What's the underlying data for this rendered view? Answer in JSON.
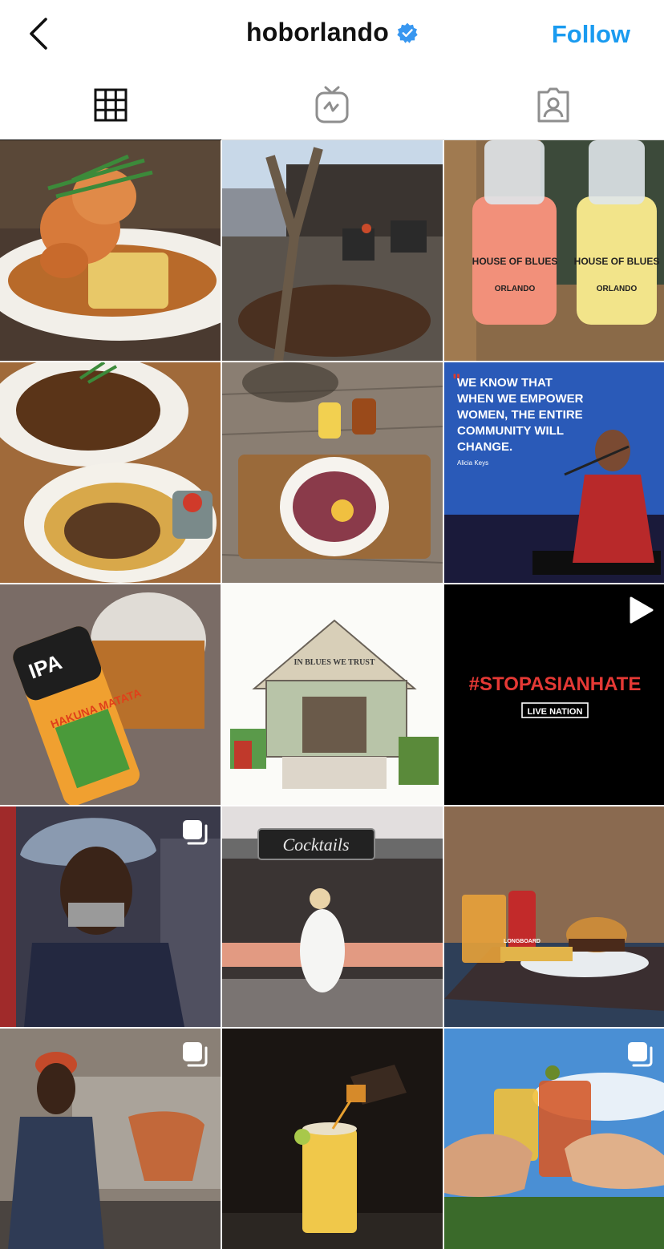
{
  "header": {
    "back_icon": "chevron-left-icon",
    "username": "hoborlando",
    "verified_icon": "verified-badge-icon",
    "follow_label": "Follow",
    "follow_color": "#1a9bf0"
  },
  "tabs": [
    {
      "name": "posts-grid",
      "icon": "grid-icon",
      "active": true
    },
    {
      "name": "igtv",
      "icon": "igtv-icon",
      "active": false
    },
    {
      "name": "tagged",
      "icon": "tagged-person-icon",
      "active": false
    }
  ],
  "posts": [
    {
      "subject": "shrimp and grits dish",
      "badge": null
    },
    {
      "subject": "outdoor patio with tree",
      "badge": null
    },
    {
      "subject": "two cocktails in House of Blues shakers",
      "badge": null,
      "cup_text_1": "HOUSE OF BLUES",
      "cup_text_2": "ORLANDO"
    },
    {
      "subject": "plates of food and fries",
      "badge": null
    },
    {
      "subject": "bowl and drinks on wicker tray",
      "badge": null
    },
    {
      "subject": "Alicia Keys quote over performance photo",
      "badge": null,
      "quote_lines": [
        "WE KNOW THAT",
        "WHEN WE EMPOWER",
        "WOMEN, THE ENTIRE",
        "COMMUNITY WILL",
        "CHANGE."
      ],
      "attribution": "Alicia Keys"
    },
    {
      "subject": "IPA can and beer glass",
      "badge": null,
      "can_text_1": "IPA",
      "can_text_2": "HAKUNA MATATA"
    },
    {
      "subject": "illustration of venue facade",
      "badge": null,
      "sign_text": "IN BLUES WE TRUST"
    },
    {
      "subject": "stop asian hate message",
      "badge": "play-icon",
      "message": "#STOPASIANHATE",
      "logo": "LIVE NATION"
    },
    {
      "subject": "man in sequined hat",
      "badge": "carousel-icon"
    },
    {
      "subject": "woman walking in front of cocktails bar",
      "badge": null,
      "sign_text": "Cocktails"
    },
    {
      "subject": "burger, fries and beer",
      "badge": null,
      "can_text": "LONGBOARD"
    },
    {
      "subject": "man in cap with painted wall",
      "badge": "carousel-icon"
    },
    {
      "subject": "bartender pouring drink",
      "badge": null
    },
    {
      "subject": "two cocktails toasting",
      "badge": "carousel-icon"
    }
  ]
}
